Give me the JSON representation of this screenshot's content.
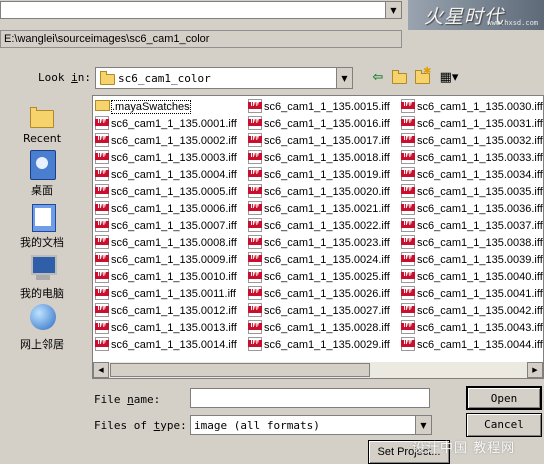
{
  "header": {
    "path": "E:\\wanglei\\sourceimages\\sc6_cam1_color",
    "brand_logo": "火星时代",
    "brand_url": "www.hxsd.com"
  },
  "lookin": {
    "label": "Look in:",
    "value": "sc6_cam1_color"
  },
  "places": [
    {
      "label": "Recent",
      "icon": "recent-folder-icon"
    },
    {
      "label": "桌面",
      "icon": "desktop-icon"
    },
    {
      "label": "我的文档",
      "icon": "my-documents-icon"
    },
    {
      "label": "我的电脑",
      "icon": "my-computer-icon"
    },
    {
      "label": "网上邻居",
      "icon": "network-places-icon"
    }
  ],
  "files": {
    "col1": [
      ".mayaSwatches",
      "sc6_cam1_1_135.0001.iff",
      "sc6_cam1_1_135.0002.iff",
      "sc6_cam1_1_135.0003.iff",
      "sc6_cam1_1_135.0004.iff",
      "sc6_cam1_1_135.0005.iff",
      "sc6_cam1_1_135.0006.iff",
      "sc6_cam1_1_135.0007.iff",
      "sc6_cam1_1_135.0008.iff",
      "sc6_cam1_1_135.0009.iff",
      "sc6_cam1_1_135.0010.iff",
      "sc6_cam1_1_135.0011.iff",
      "sc6_cam1_1_135.0012.iff",
      "sc6_cam1_1_135.0013.iff",
      "sc6_cam1_1_135.0014.iff"
    ],
    "col2": [
      "sc6_cam1_1_135.0015.iff",
      "sc6_cam1_1_135.0016.iff",
      "sc6_cam1_1_135.0017.iff",
      "sc6_cam1_1_135.0018.iff",
      "sc6_cam1_1_135.0019.iff",
      "sc6_cam1_1_135.0020.iff",
      "sc6_cam1_1_135.0021.iff",
      "sc6_cam1_1_135.0022.iff",
      "sc6_cam1_1_135.0023.iff",
      "sc6_cam1_1_135.0024.iff",
      "sc6_cam1_1_135.0025.iff",
      "sc6_cam1_1_135.0026.iff",
      "sc6_cam1_1_135.0027.iff",
      "sc6_cam1_1_135.0028.iff",
      "sc6_cam1_1_135.0029.iff"
    ],
    "col3": [
      "sc6_cam1_1_135.0030.iff",
      "sc6_cam1_1_135.0031.iff",
      "sc6_cam1_1_135.0032.iff",
      "sc6_cam1_1_135.0033.iff",
      "sc6_cam1_1_135.0034.iff",
      "sc6_cam1_1_135.0035.iff",
      "sc6_cam1_1_135.0036.iff",
      "sc6_cam1_1_135.0037.iff",
      "sc6_cam1_1_135.0038.iff",
      "sc6_cam1_1_135.0039.iff",
      "sc6_cam1_1_135.0040.iff",
      "sc6_cam1_1_135.0041.iff",
      "sc6_cam1_1_135.0042.iff",
      "sc6_cam1_1_135.0043.iff",
      "sc6_cam1_1_135.0044.iff"
    ]
  },
  "form": {
    "filename_label": "File name:",
    "filename_value": "",
    "filetype_label": "Files of type:",
    "filetype_value": "image (all formats)",
    "open_button": "Open",
    "cancel_button": "Cancel",
    "set_project_button": "Set Project..."
  },
  "watermark": "设计中国 教程网"
}
